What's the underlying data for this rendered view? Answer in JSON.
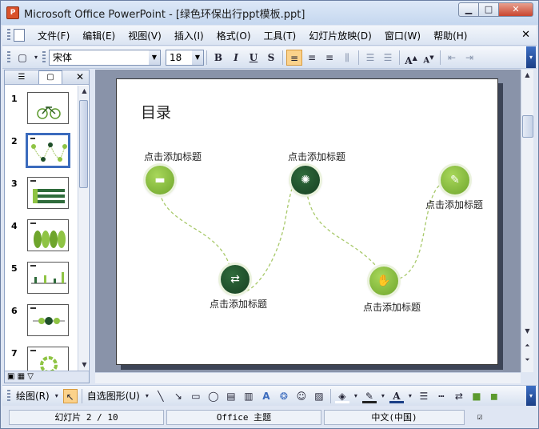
{
  "window": {
    "title": "Microsoft Office PowerPoint - [绿色环保出行ppt模板.ppt]",
    "app_icon": "P"
  },
  "menu": {
    "items": [
      "文件(F)",
      "编辑(E)",
      "视图(V)",
      "插入(I)",
      "格式(O)",
      "工具(T)",
      "幻灯片放映(D)",
      "窗口(W)",
      "帮助(H)"
    ]
  },
  "format_toolbar": {
    "font_name": "宋体",
    "font_size": "18",
    "bold": "B",
    "italic": "I",
    "underline": "U",
    "shadow": "S",
    "grow_font": "A",
    "shrink_font": "A"
  },
  "slides_panel": {
    "numbers": [
      "1",
      "2",
      "3",
      "4",
      "5",
      "6",
      "7"
    ],
    "selected": 2
  },
  "slide": {
    "title": "目录",
    "labels": [
      "点击添加标题",
      "点击添加标题",
      "点击添加标题",
      "点击添加标题",
      "点击添加标题"
    ],
    "colors": {
      "light_green": "#8fc444",
      "dark_green": "#1f4f2a",
      "dash": "#a8c96a"
    }
  },
  "drawing_toolbar": {
    "draw_label": "绘图(R)",
    "autoshapes_label": "自选图形(U)"
  },
  "status": {
    "slide_info": "幻灯片 2 / 10",
    "theme": "Office 主题",
    "language": "中文(中国)"
  },
  "colors": {
    "accent": "#3b6bbd",
    "active_button": "#fbd28b"
  }
}
